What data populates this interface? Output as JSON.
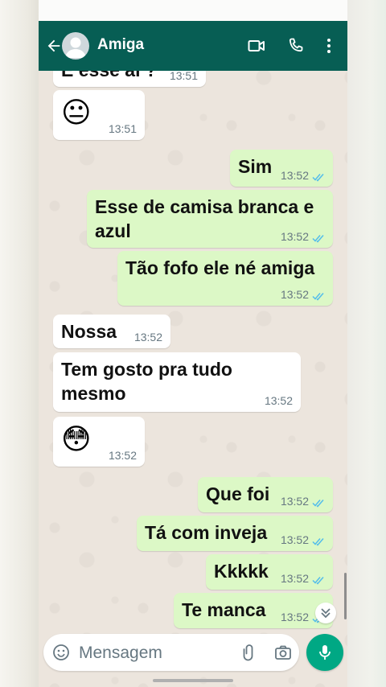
{
  "header": {
    "contact_name": "Amiga",
    "icons": [
      "back-arrow-icon",
      "avatar",
      "video-call-icon",
      "voice-call-icon",
      "more-options-icon"
    ]
  },
  "messages": [
    {
      "dir": "in",
      "text": "E esse aí ?",
      "time": "13:51"
    },
    {
      "dir": "in",
      "text": "😐",
      "time": "13:51",
      "emoji": true
    },
    {
      "dir": "out",
      "text": "Sim",
      "time": "13:52",
      "status": "read"
    },
    {
      "dir": "out",
      "text": "Esse de camisa branca e azul",
      "time": "13:52",
      "status": "read"
    },
    {
      "dir": "out",
      "text": "Tão fofo ele né amiga",
      "time": "13:52",
      "status": "read"
    },
    {
      "dir": "in",
      "text": "Nossa",
      "time": "13:52"
    },
    {
      "dir": "in",
      "text": "Tem gosto pra tudo mesmo",
      "time": "13:52"
    },
    {
      "dir": "in",
      "text": "😳",
      "time": "13:52",
      "emoji": true
    },
    {
      "dir": "out",
      "text": "Que foi",
      "time": "13:52",
      "status": "read"
    },
    {
      "dir": "out",
      "text": "Tá com inveja",
      "time": "13:52",
      "status": "read"
    },
    {
      "dir": "out",
      "text": "Kkkkk",
      "time": "13:52",
      "status": "read"
    },
    {
      "dir": "out",
      "text": "Te manca",
      "time": "13:52",
      "status": "read"
    }
  ],
  "composer": {
    "placeholder": "Mensagem"
  },
  "colors": {
    "header": "#075e54",
    "outgoing_bubble": "#dcf8c6",
    "incoming_bubble": "#ffffff",
    "chat_background": "#ece5dd",
    "mic_button": "#00a884",
    "read_ticks": "#53bdeb"
  }
}
